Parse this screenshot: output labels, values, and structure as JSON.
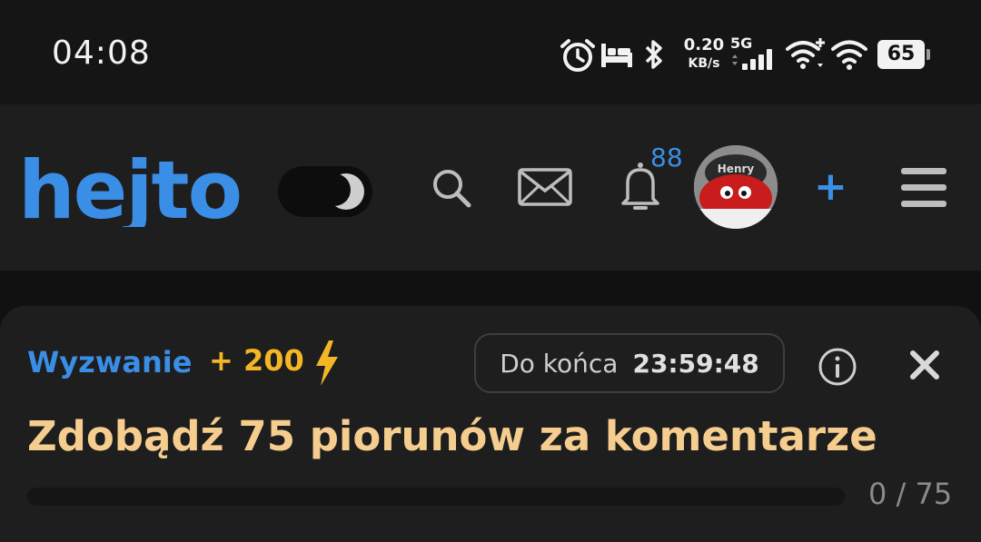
{
  "status_bar": {
    "time": "04:08",
    "net_speed_value": "0.20",
    "net_speed_unit": "KB/s",
    "network_type": "5G",
    "battery_level": "65",
    "icons": [
      "alarm-icon",
      "bed-icon",
      "bluetooth-icon",
      "signal-icon",
      "wifi-plus-icon",
      "wifi-icon",
      "battery-icon"
    ]
  },
  "header": {
    "logo_text": "hejto",
    "notifications_count": "88",
    "avatar_text": "Henry",
    "add_label": "+",
    "accent_color": "#3a8ee6",
    "icons": [
      "theme-toggle-icon",
      "search-icon",
      "mail-icon",
      "bell-icon",
      "menu-icon"
    ]
  },
  "challenge": {
    "label": "Wyzwanie",
    "points": "+ 200",
    "timer_label": "Do końca",
    "timer_value": "23:59:48",
    "title": "Zdobądź 75 piorunów za komentarze",
    "progress_text": "0 / 75",
    "progress_value": 0,
    "progress_target": 75,
    "points_color": "#f4b625",
    "title_color": "#f5cd8f"
  }
}
